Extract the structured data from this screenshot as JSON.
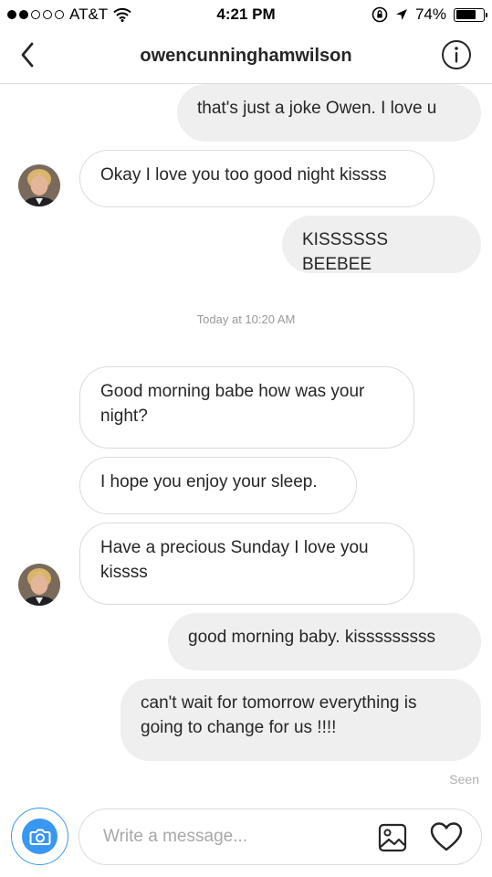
{
  "status_bar": {
    "carrier": "AT&T",
    "time": "4:21 PM",
    "battery": "74%",
    "battery_level": 0.74,
    "signal_bars_filled": 2,
    "signal_bars_total": 5
  },
  "header": {
    "title": "owencunninghamwilson",
    "back_icon": "chevron-left-icon",
    "info_icon": "info-icon"
  },
  "thread": {
    "messages": [
      {
        "from": "me",
        "text": "that's just a joke Owen. I love u"
      },
      {
        "from": "them",
        "text": "Okay I love you too good night kissss",
        "avatar": true
      },
      {
        "from": "me",
        "text": "KISSSSSS BEEBEE"
      },
      {
        "type": "timestamp",
        "text": "Today at 10:20 AM"
      },
      {
        "from": "them",
        "text": "Good morning babe how was your night?"
      },
      {
        "from": "them",
        "text": "I hope you enjoy your sleep."
      },
      {
        "from": "them",
        "text": "Have a precious Sunday I love you kissss",
        "avatar": true
      },
      {
        "from": "me",
        "text": "good morning baby. kisssssssss"
      },
      {
        "from": "me",
        "text": "can't wait for tomorrow everything  is going to change for us !!!!"
      }
    ],
    "seen_label": "Seen"
  },
  "composer": {
    "placeholder": "Write a message...",
    "value": "",
    "camera_icon": "camera-icon",
    "gallery_icon": "gallery-icon",
    "heart_icon": "heart-icon"
  },
  "colors": {
    "accent": "#3897f0",
    "bubble_outgoing": "#efefef",
    "bubble_border": "#dbdbdb"
  }
}
